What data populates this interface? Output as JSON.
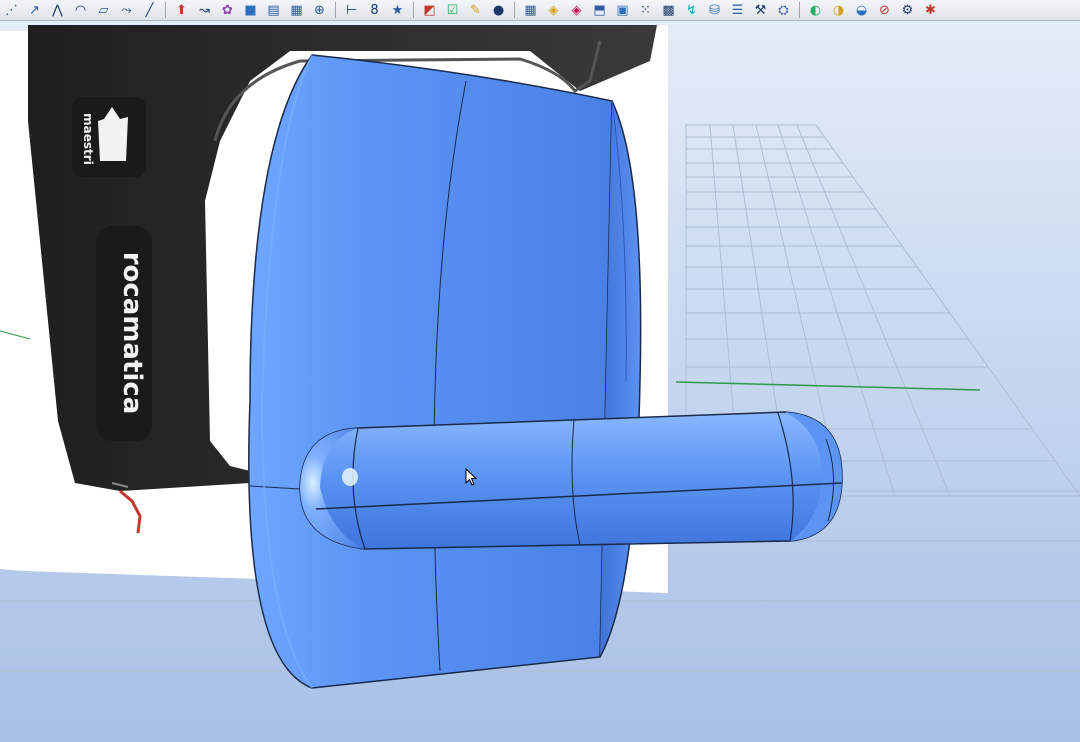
{
  "window": {
    "title": ""
  },
  "toolbar": {
    "icons": [
      {
        "name": "point-icon",
        "glyph": "⋰",
        "color": "#2c5aa0"
      },
      {
        "name": "curve-icon",
        "glyph": "↗",
        "color": "#2c5aa0"
      },
      {
        "name": "polyline-icon",
        "glyph": "⋀",
        "color": "#1b3a6b"
      },
      {
        "name": "arc-icon",
        "glyph": "◠",
        "color": "#1b3a6b"
      },
      {
        "name": "rectangle-icon",
        "glyph": "▱",
        "color": "#2c5aa0"
      },
      {
        "name": "freeform-icon",
        "glyph": "⤳",
        "color": "#1b3a6b"
      },
      {
        "name": "line-icon",
        "glyph": "╱",
        "color": "#1b3a6b"
      },
      {
        "sep": true
      },
      {
        "name": "extrude-icon",
        "glyph": "⬆",
        "color": "#c0392b"
      },
      {
        "name": "sweep-icon",
        "glyph": "↝",
        "color": "#1b3a6b"
      },
      {
        "name": "network-surface-icon",
        "glyph": "✿",
        "color": "#8e44ad"
      },
      {
        "name": "box-icon",
        "glyph": "■",
        "color": "#2c6fbf"
      },
      {
        "name": "loft-icon",
        "glyph": "▤",
        "color": "#2c5aa0"
      },
      {
        "name": "patch-icon",
        "glyph": "▦",
        "color": "#2c5aa0"
      },
      {
        "name": "sphere-icon",
        "glyph": "⊕",
        "color": "#2c5aa0"
      },
      {
        "sep": true
      },
      {
        "name": "join-icon",
        "glyph": "⊢",
        "color": "#1b3a6b"
      },
      {
        "name": "explode-icon",
        "glyph": "8",
        "color": "#1b3a6b"
      },
      {
        "name": "star-icon",
        "glyph": "★",
        "color": "#2c5aa0"
      },
      {
        "sep": true
      },
      {
        "name": "analyze-icon",
        "glyph": "◩",
        "color": "#c0392b"
      },
      {
        "name": "check-icon",
        "glyph": "☑",
        "color": "#27ae60"
      },
      {
        "name": "paint-icon",
        "glyph": "✎",
        "color": "#d4a017"
      },
      {
        "name": "fill-icon",
        "glyph": "●",
        "color": "#1b3a6b"
      },
      {
        "sep": true
      },
      {
        "name": "grid-icon",
        "glyph": "▦",
        "color": "#2c5aa0"
      },
      {
        "name": "cube-yellow-icon",
        "glyph": "◈",
        "color": "#d4a017"
      },
      {
        "name": "cube-pink-icon",
        "glyph": "◈",
        "color": "#c2185b"
      },
      {
        "name": "unroll-icon",
        "glyph": "⬒",
        "color": "#2c5aa0"
      },
      {
        "name": "frame-icon",
        "glyph": "▣",
        "color": "#2c6fbf"
      },
      {
        "name": "points-on-icon",
        "glyph": "⁙",
        "color": "#1b3a6b"
      },
      {
        "name": "mesh-icon",
        "glyph": "▩",
        "color": "#1b3a6b"
      },
      {
        "name": "flow-icon",
        "glyph": "↯",
        "color": "#16a2b8"
      },
      {
        "name": "cylinder-icon",
        "glyph": "⛁",
        "color": "#2c6fbf"
      },
      {
        "name": "list-icon",
        "glyph": "☰",
        "color": "#2c5aa0"
      },
      {
        "name": "tools-icon",
        "glyph": "⚒",
        "color": "#1b3a6b"
      },
      {
        "name": "group-icon",
        "glyph": "⛭",
        "color": "#2c5aa0"
      },
      {
        "sep": true
      },
      {
        "name": "render-sphere-icon",
        "glyph": "◐",
        "color": "#27ae60"
      },
      {
        "name": "material-sphere-icon",
        "glyph": "◑",
        "color": "#d4a017"
      },
      {
        "name": "light-sphere-icon",
        "glyph": "◒",
        "color": "#2c6fbf"
      },
      {
        "name": "no-render-icon",
        "glyph": "⊘",
        "color": "#c0392b"
      },
      {
        "name": "settings-icon",
        "glyph": "⚙",
        "color": "#1b3a6b"
      },
      {
        "name": "bug-icon",
        "glyph": "✱",
        "color": "#c0392b"
      }
    ]
  },
  "product": {
    "logo_text": "maestri",
    "brand_text": "rocamatica"
  },
  "scene": {
    "background_top": "#dfe8f5",
    "background_bottom": "#a9c2e6",
    "object_color": "#4f86ea",
    "object_highlight": "#7fb0ff",
    "grid_color": "#a9b8ce",
    "axis_color": "#2f9a4a",
    "housing_color": "#2b2b2b"
  }
}
